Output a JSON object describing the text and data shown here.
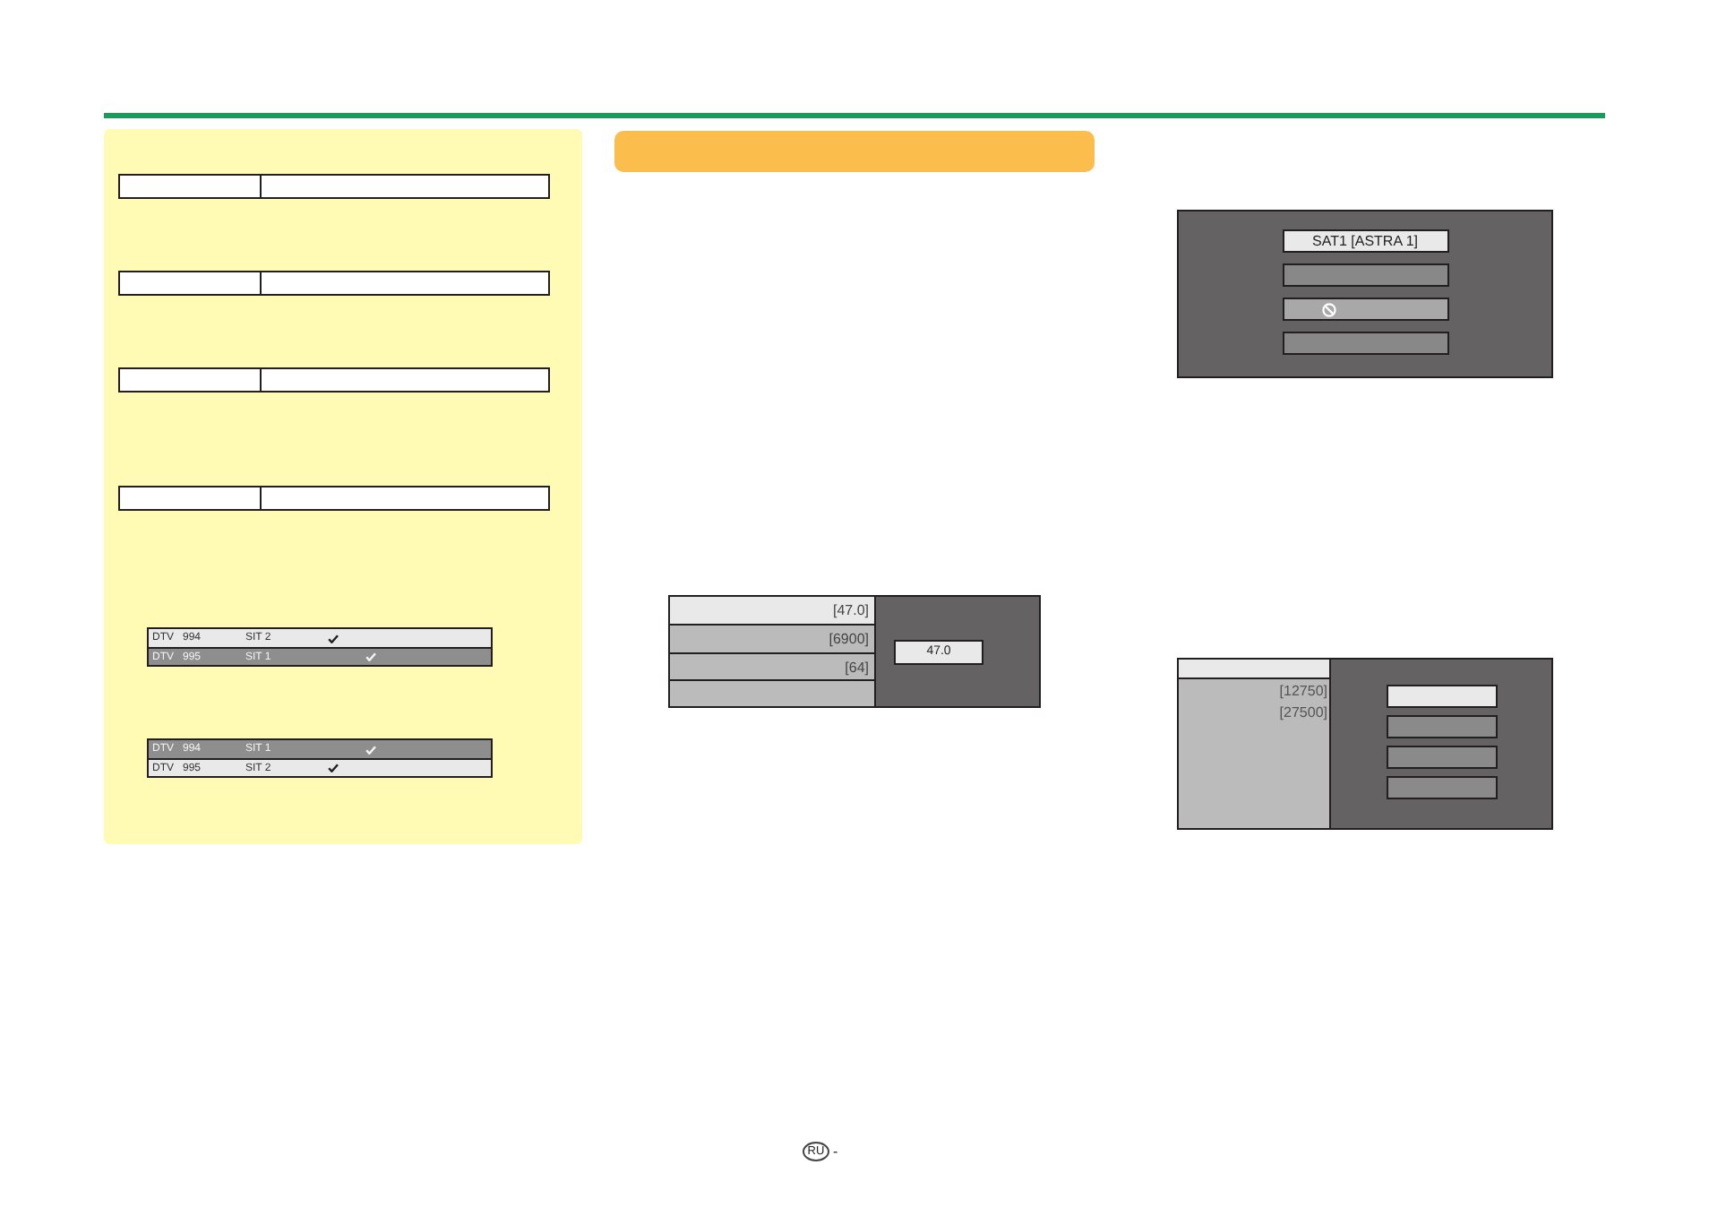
{
  "note_panel": {
    "channel_lists": [
      {
        "rows": [
          {
            "type": "DTV",
            "number": "994",
            "name": "SIT 2",
            "checks": [
              true,
              false
            ],
            "selected": false
          },
          {
            "type": "DTV",
            "number": "995",
            "name": "SIT 1",
            "checks": [
              false,
              true
            ],
            "selected": true
          }
        ]
      },
      {
        "rows": [
          {
            "type": "DTV",
            "number": "994",
            "name": "SIT 1",
            "checks": [
              false,
              true
            ],
            "selected": true
          },
          {
            "type": "DTV",
            "number": "995",
            "name": "SIT 2",
            "checks": [
              true,
              false
            ],
            "selected": false
          }
        ]
      }
    ]
  },
  "tuning_panel": {
    "rows": [
      {
        "value": "[47.0]",
        "selected": true
      },
      {
        "value": "[6900]",
        "selected": false
      },
      {
        "value": "[64]",
        "selected": false
      },
      {
        "selected": false
      }
    ],
    "input": {
      "value": "47.0"
    }
  },
  "satellite_menu": {
    "items": [
      {
        "kind": "text",
        "label": "SAT1 [ASTRA 1]",
        "selected": true
      },
      {
        "kind": "blank",
        "selected": false
      },
      {
        "kind": "icon",
        "selected": false
      },
      {
        "kind": "blank",
        "selected": false
      }
    ]
  },
  "frequency_panel": {
    "values": [
      "[12750]",
      "[27500]"
    ],
    "buttons": [
      {
        "selected": true
      },
      {
        "selected": false
      },
      {
        "selected": false
      },
      {
        "selected": false
      }
    ]
  },
  "footer": {
    "language_code": "RU",
    "separator": "-"
  }
}
